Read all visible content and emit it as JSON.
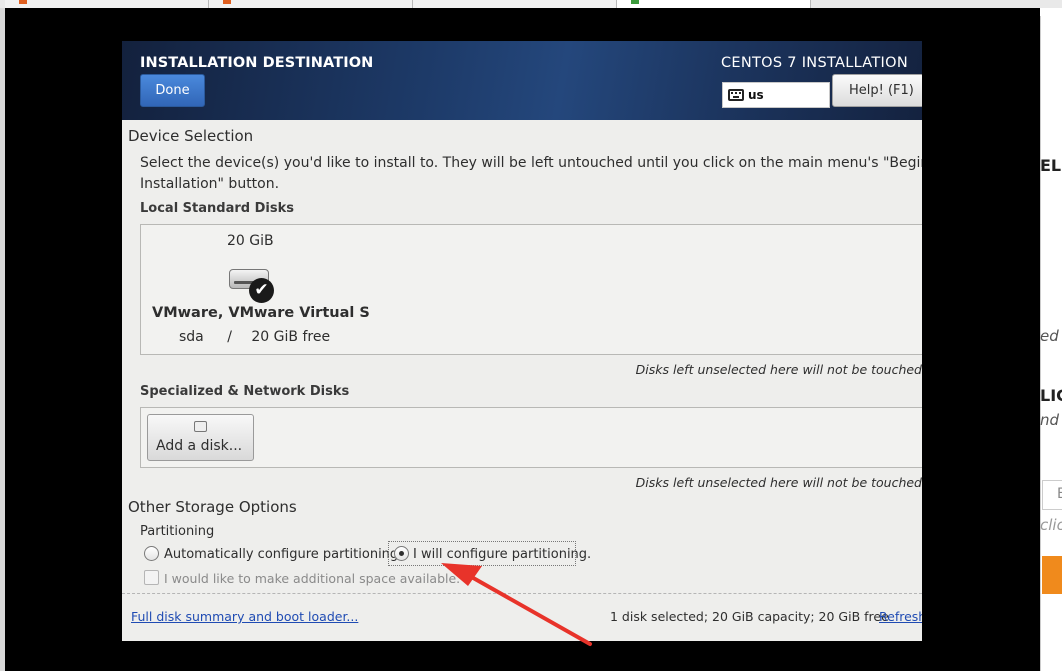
{
  "header": {
    "title": "INSTALLATION DESTINATION",
    "product": "CENTOS 7 INSTALLATION",
    "done_label": "Done",
    "keyboard_layout": "us",
    "help_label": "Help! (F1)"
  },
  "device_selection": {
    "heading": "Device Selection",
    "intro_line1": "Select the device(s) you'd like to install to.  They will be left untouched until you click on the main menu's \"Begin",
    "intro_line2": "Installation\" button.",
    "local_heading": "Local Standard Disks",
    "disk": {
      "size": "20 GiB",
      "name": "VMware, VMware Virtual S",
      "device": "sda",
      "separator": "/",
      "free": "20 GiB free",
      "selected": true
    },
    "local_note": "Disks left unselected here will not be touched",
    "specialized_heading": "Specialized & Network Disks",
    "add_disk_label": "Add a disk...",
    "specialized_note": "Disks left unselected here will not be touched"
  },
  "other_storage": {
    "heading": "Other Storage Options",
    "partitioning_heading": "Partitioning",
    "auto_label": "Automatically configure partitioning.",
    "manual_label": "I will configure partitioning.",
    "manual_selected": true,
    "extra_space_label": "I would like to make additional space available."
  },
  "footer": {
    "summary_link": "Full disk summary and boot loader...",
    "status": "1 disk selected; 20 GiB capacity; 20 GiB free",
    "refresh_link": "Refresh"
  },
  "host_fragments": {
    "frag1": "ELI",
    "frag2": "ed",
    "frag3": "LIC",
    "frag4": "nd",
    "frag5": "E",
    "frag6": "clic"
  },
  "colors": {
    "done_button": "#3a75c4",
    "annotation_arrow": "#e8332a",
    "link": "#1f4bb3"
  }
}
